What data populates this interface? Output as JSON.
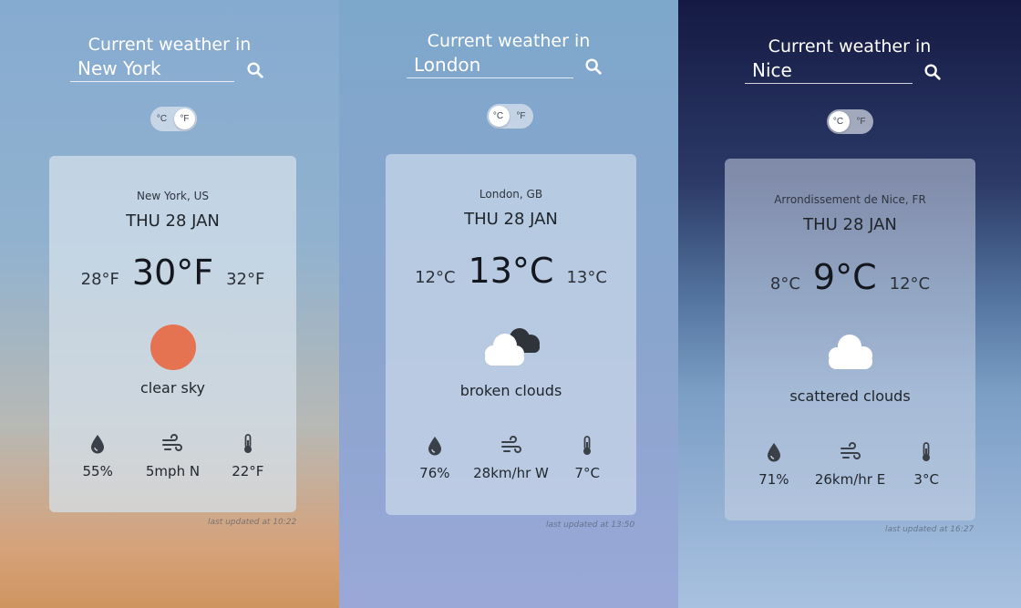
{
  "panels": [
    {
      "heading": "Current weather in",
      "city_value": "New York",
      "unit_toggle": {
        "c_label": "°C",
        "f_label": "°F",
        "selected": "°F"
      },
      "card": {
        "location": "New York, US",
        "date": "THU 28 JAN",
        "temp_min": "28°F",
        "temp_current": "30°F",
        "temp_max": "32°F",
        "condition_icon": "sun-icon",
        "description": "clear sky",
        "humidity": "55%",
        "wind": "5mph N",
        "feels_like": "22°F"
      },
      "last_updated": "last updated at 10:22",
      "colors": {
        "sun": "#e57251"
      }
    },
    {
      "heading": "Current weather in",
      "city_value": "London",
      "unit_toggle": {
        "c_label": "°C",
        "f_label": "°F",
        "selected": "°C"
      },
      "card": {
        "location": "London, GB",
        "date": "THU 28 JAN",
        "temp_min": "12°C",
        "temp_current": "13°C",
        "temp_max": "13°C",
        "condition_icon": "broken-clouds-icon",
        "description": "broken clouds",
        "humidity": "76%",
        "wind": "28km/hr W",
        "feels_like": "7°C"
      },
      "last_updated": "last updated at 13:50"
    },
    {
      "heading": "Current weather in",
      "city_value": "Nice",
      "unit_toggle": {
        "c_label": "°C",
        "f_label": "°F",
        "selected": "°C"
      },
      "card": {
        "location": "Arrondissement de Nice, FR",
        "date": "THU 28 JAN",
        "temp_min": "8°C",
        "temp_current": "9°C",
        "temp_max": "12°C",
        "condition_icon": "scattered-clouds-icon",
        "description": "scattered clouds",
        "humidity": "71%",
        "wind": "26km/hr E",
        "feels_like": "3°C"
      },
      "last_updated": "last updated at 16:27"
    }
  ],
  "icons": {
    "search": "search-icon",
    "humidity": "humidity-drop-icon",
    "wind": "wind-icon",
    "feels_like": "thermometer-icon"
  }
}
